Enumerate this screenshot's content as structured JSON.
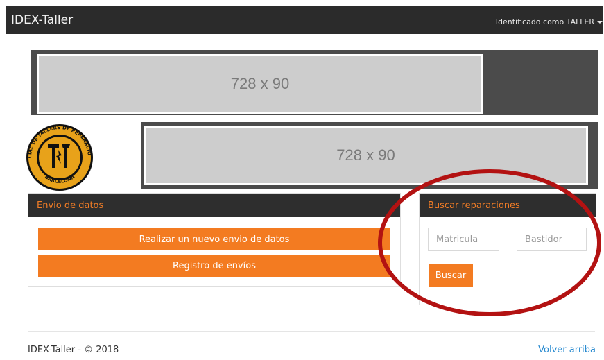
{
  "navbar": {
    "brand": "IDEX-Taller",
    "user_menu_label": "Identificado como TALLER"
  },
  "banners": {
    "top_label": "728 x 90",
    "second_label": "728 x 90"
  },
  "logo": {
    "ring_text_top": "GREMI PROVINCIAL DE TALLERS DE REPARACIÓ D'AUTOMÒBILS",
    "ring_text_bottom": "BARCELONA"
  },
  "panel_envio": {
    "title": "Envio de datos",
    "new_button": "Realizar un nuevo envio de datos",
    "registry_button": "Registro de envíos"
  },
  "panel_buscar": {
    "title": "Buscar reparaciones",
    "matricula_placeholder": "Matricula",
    "bastidor_placeholder": "Bastidor",
    "search_button": "Buscar"
  },
  "footer": {
    "copyright": "IDEX-Taller - © 2018",
    "back_to_top": "Volver arriba"
  },
  "colors": {
    "accent": "#f37b21",
    "navbar": "#2b2b2b",
    "highlight_ellipse": "#b31212",
    "link": "#2a8bd0"
  }
}
